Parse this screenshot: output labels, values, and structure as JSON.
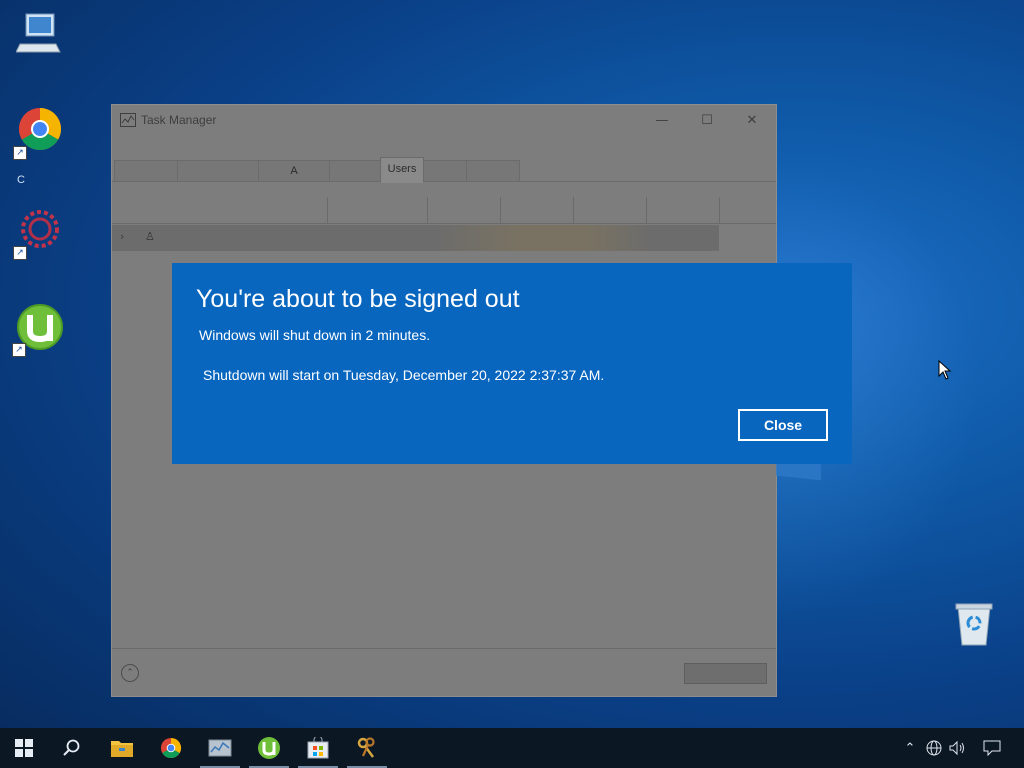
{
  "desktop": {
    "icons": [
      {
        "name": "This PC"
      },
      {
        "name": "Google Chrome"
      },
      {
        "name": "Settings"
      },
      {
        "name": "uTorrent"
      }
    ],
    "partial_label": "C",
    "recycle_bin": "Recycle Bin"
  },
  "task_manager": {
    "title": "Task Manager",
    "tabs": [
      "",
      "",
      "A",
      "",
      "Users",
      "",
      ""
    ],
    "active_tab": "Users",
    "user_row_icon": "user-icon"
  },
  "dialog": {
    "title": "You're about to be signed out",
    "message": "Windows will shut down in 2 minutes.",
    "detail": "Shutdown will start on Tuesday, December 20, 2022 2:37:37 AM.",
    "close_label": "Close",
    "background": "#0866bf"
  },
  "taskbar": {
    "items": [
      "start-icon",
      "search-icon",
      "file-explorer-icon",
      "chrome-icon",
      "task-manager-icon",
      "utorrent-icon",
      "microsoft-store-icon",
      "keys-app-icon"
    ],
    "tray": [
      "show-hidden-icons-chevron",
      "network-globe-icon",
      "volume-icon",
      "action-center-icon"
    ],
    "background": "#0c1724"
  }
}
